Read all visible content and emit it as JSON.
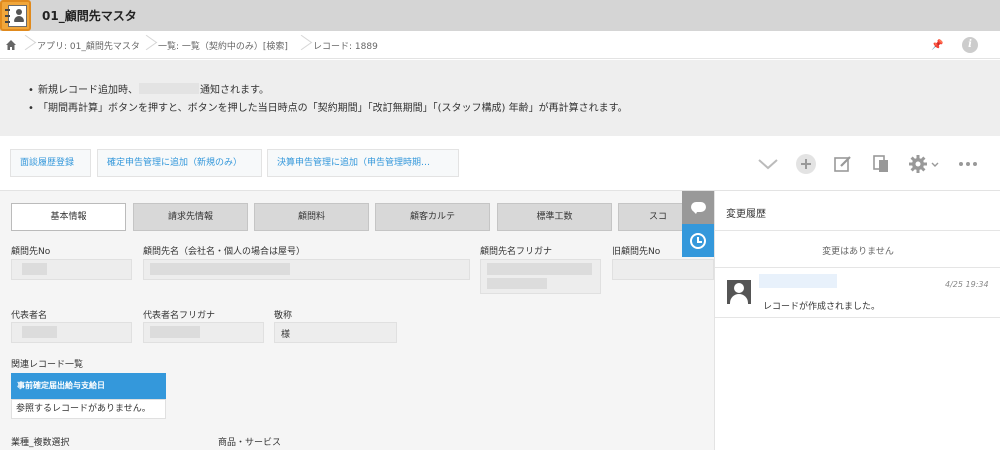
{
  "app": {
    "title": "01_顧問先マスタ",
    "icon": "address-book-icon"
  },
  "breadcrumb": {
    "app": "アプリ: 01_顧問先マスタ",
    "view": "一覧: 一覧（契約中のみ）[検索]",
    "record": "レコード: 1889"
  },
  "notice": {
    "line1_before": "新規レコード追加時、",
    "line1_after": "通知されます。",
    "line2": "「期間再計算」ボタンを押すと、ボタンを押した当日時点の「契約期間」「改訂無期間」「(スタッフ構成) 年齢」が再計算されます。"
  },
  "actions": {
    "btn1": "面談履歴登録",
    "btn2": "確定申告管理に追加（新規のみ）",
    "btn3": "決算申告管理に追加（申告管理時期…"
  },
  "tabs": [
    "基本情報",
    "請求先情報",
    "顧問料",
    "顧客カルテ",
    "標準工数",
    "スコ"
  ],
  "fields": {
    "client_no": "顧問先No",
    "client_name": "顧問先名（会社名・個人の場合は屋号）",
    "client_kana": "顧問先名フリガナ",
    "old_client_no": "旧顧問先No",
    "rep_name": "代表者名",
    "rep_kana": "代表者名フリガナ",
    "honorific_label": "敬称",
    "honorific_value": "様",
    "industry": "業種_複数選択",
    "products": "商品・サービス"
  },
  "related": {
    "title": "関連レコード一覧",
    "header": "事前確定届出給与支給日",
    "empty": "参照するレコードがありません。"
  },
  "history": {
    "title": "変更履歴",
    "no_change": "変更はありません",
    "comment_time": "4/25 19:34",
    "comment_text": "レコードが作成されました。"
  },
  "colors": {
    "accent": "#3498db",
    "title_bar": "#d5d5d5",
    "notice_bg": "#eeeeee"
  }
}
